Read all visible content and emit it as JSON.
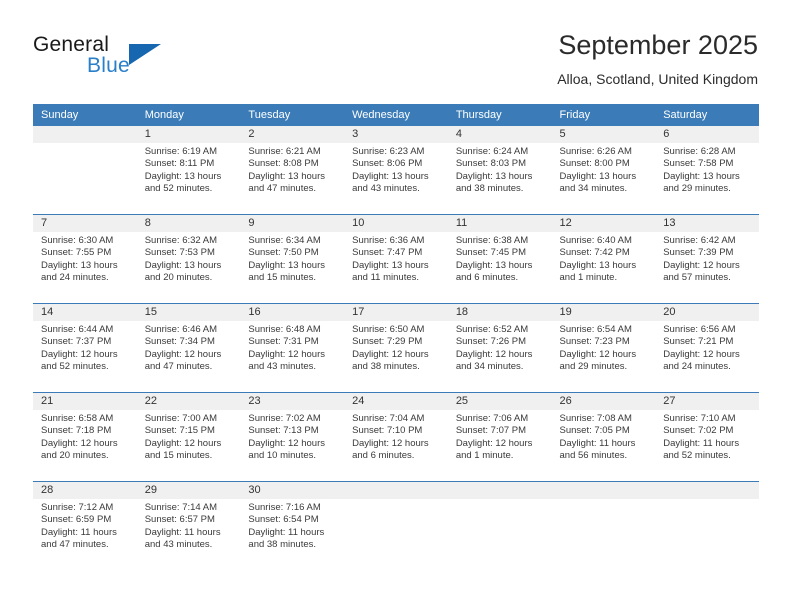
{
  "brand": {
    "word_one": "General",
    "word_two": "Blue",
    "flag_icon": "blue-triangle-flag-icon",
    "accent_color": "#1667b0",
    "blue_text_color": "#2a7fc9"
  },
  "header": {
    "month_title": "September 2025",
    "location": "Alloa, Scotland, United Kingdom"
  },
  "calendar": {
    "header_bg": "#3b7cb8",
    "daynum_bg": "#f0f0f0",
    "weekdays": [
      "Sunday",
      "Monday",
      "Tuesday",
      "Wednesday",
      "Thursday",
      "Friday",
      "Saturday"
    ],
    "weeks": [
      [
        {
          "day": "",
          "empty": true,
          "sunrise": "",
          "sunset": "",
          "daylight": ""
        },
        {
          "day": "1",
          "empty": false,
          "sunrise": "Sunrise: 6:19 AM",
          "sunset": "Sunset: 8:11 PM",
          "daylight": "Daylight: 13 hours and 52 minutes."
        },
        {
          "day": "2",
          "empty": false,
          "sunrise": "Sunrise: 6:21 AM",
          "sunset": "Sunset: 8:08 PM",
          "daylight": "Daylight: 13 hours and 47 minutes."
        },
        {
          "day": "3",
          "empty": false,
          "sunrise": "Sunrise: 6:23 AM",
          "sunset": "Sunset: 8:06 PM",
          "daylight": "Daylight: 13 hours and 43 minutes."
        },
        {
          "day": "4",
          "empty": false,
          "sunrise": "Sunrise: 6:24 AM",
          "sunset": "Sunset: 8:03 PM",
          "daylight": "Daylight: 13 hours and 38 minutes."
        },
        {
          "day": "5",
          "empty": false,
          "sunrise": "Sunrise: 6:26 AM",
          "sunset": "Sunset: 8:00 PM",
          "daylight": "Daylight: 13 hours and 34 minutes."
        },
        {
          "day": "6",
          "empty": false,
          "sunrise": "Sunrise: 6:28 AM",
          "sunset": "Sunset: 7:58 PM",
          "daylight": "Daylight: 13 hours and 29 minutes."
        }
      ],
      [
        {
          "day": "7",
          "empty": false,
          "sunrise": "Sunrise: 6:30 AM",
          "sunset": "Sunset: 7:55 PM",
          "daylight": "Daylight: 13 hours and 24 minutes."
        },
        {
          "day": "8",
          "empty": false,
          "sunrise": "Sunrise: 6:32 AM",
          "sunset": "Sunset: 7:53 PM",
          "daylight": "Daylight: 13 hours and 20 minutes."
        },
        {
          "day": "9",
          "empty": false,
          "sunrise": "Sunrise: 6:34 AM",
          "sunset": "Sunset: 7:50 PM",
          "daylight": "Daylight: 13 hours and 15 minutes."
        },
        {
          "day": "10",
          "empty": false,
          "sunrise": "Sunrise: 6:36 AM",
          "sunset": "Sunset: 7:47 PM",
          "daylight": "Daylight: 13 hours and 11 minutes."
        },
        {
          "day": "11",
          "empty": false,
          "sunrise": "Sunrise: 6:38 AM",
          "sunset": "Sunset: 7:45 PM",
          "daylight": "Daylight: 13 hours and 6 minutes."
        },
        {
          "day": "12",
          "empty": false,
          "sunrise": "Sunrise: 6:40 AM",
          "sunset": "Sunset: 7:42 PM",
          "daylight": "Daylight: 13 hours and 1 minute."
        },
        {
          "day": "13",
          "empty": false,
          "sunrise": "Sunrise: 6:42 AM",
          "sunset": "Sunset: 7:39 PM",
          "daylight": "Daylight: 12 hours and 57 minutes."
        }
      ],
      [
        {
          "day": "14",
          "empty": false,
          "sunrise": "Sunrise: 6:44 AM",
          "sunset": "Sunset: 7:37 PM",
          "daylight": "Daylight: 12 hours and 52 minutes."
        },
        {
          "day": "15",
          "empty": false,
          "sunrise": "Sunrise: 6:46 AM",
          "sunset": "Sunset: 7:34 PM",
          "daylight": "Daylight: 12 hours and 47 minutes."
        },
        {
          "day": "16",
          "empty": false,
          "sunrise": "Sunrise: 6:48 AM",
          "sunset": "Sunset: 7:31 PM",
          "daylight": "Daylight: 12 hours and 43 minutes."
        },
        {
          "day": "17",
          "empty": false,
          "sunrise": "Sunrise: 6:50 AM",
          "sunset": "Sunset: 7:29 PM",
          "daylight": "Daylight: 12 hours and 38 minutes."
        },
        {
          "day": "18",
          "empty": false,
          "sunrise": "Sunrise: 6:52 AM",
          "sunset": "Sunset: 7:26 PM",
          "daylight": "Daylight: 12 hours and 34 minutes."
        },
        {
          "day": "19",
          "empty": false,
          "sunrise": "Sunrise: 6:54 AM",
          "sunset": "Sunset: 7:23 PM",
          "daylight": "Daylight: 12 hours and 29 minutes."
        },
        {
          "day": "20",
          "empty": false,
          "sunrise": "Sunrise: 6:56 AM",
          "sunset": "Sunset: 7:21 PM",
          "daylight": "Daylight: 12 hours and 24 minutes."
        }
      ],
      [
        {
          "day": "21",
          "empty": false,
          "sunrise": "Sunrise: 6:58 AM",
          "sunset": "Sunset: 7:18 PM",
          "daylight": "Daylight: 12 hours and 20 minutes."
        },
        {
          "day": "22",
          "empty": false,
          "sunrise": "Sunrise: 7:00 AM",
          "sunset": "Sunset: 7:15 PM",
          "daylight": "Daylight: 12 hours and 15 minutes."
        },
        {
          "day": "23",
          "empty": false,
          "sunrise": "Sunrise: 7:02 AM",
          "sunset": "Sunset: 7:13 PM",
          "daylight": "Daylight: 12 hours and 10 minutes."
        },
        {
          "day": "24",
          "empty": false,
          "sunrise": "Sunrise: 7:04 AM",
          "sunset": "Sunset: 7:10 PM",
          "daylight": "Daylight: 12 hours and 6 minutes."
        },
        {
          "day": "25",
          "empty": false,
          "sunrise": "Sunrise: 7:06 AM",
          "sunset": "Sunset: 7:07 PM",
          "daylight": "Daylight: 12 hours and 1 minute."
        },
        {
          "day": "26",
          "empty": false,
          "sunrise": "Sunrise: 7:08 AM",
          "sunset": "Sunset: 7:05 PM",
          "daylight": "Daylight: 11 hours and 56 minutes."
        },
        {
          "day": "27",
          "empty": false,
          "sunrise": "Sunrise: 7:10 AM",
          "sunset": "Sunset: 7:02 PM",
          "daylight": "Daylight: 11 hours and 52 minutes."
        }
      ],
      [
        {
          "day": "28",
          "empty": false,
          "sunrise": "Sunrise: 7:12 AM",
          "sunset": "Sunset: 6:59 PM",
          "daylight": "Daylight: 11 hours and 47 minutes."
        },
        {
          "day": "29",
          "empty": false,
          "sunrise": "Sunrise: 7:14 AM",
          "sunset": "Sunset: 6:57 PM",
          "daylight": "Daylight: 11 hours and 43 minutes."
        },
        {
          "day": "30",
          "empty": false,
          "sunrise": "Sunrise: 7:16 AM",
          "sunset": "Sunset: 6:54 PM",
          "daylight": "Daylight: 11 hours and 38 minutes."
        },
        {
          "day": "",
          "empty": true,
          "sunrise": "",
          "sunset": "",
          "daylight": ""
        },
        {
          "day": "",
          "empty": true,
          "sunrise": "",
          "sunset": "",
          "daylight": ""
        },
        {
          "day": "",
          "empty": true,
          "sunrise": "",
          "sunset": "",
          "daylight": ""
        },
        {
          "day": "",
          "empty": true,
          "sunrise": "",
          "sunset": "",
          "daylight": ""
        }
      ]
    ]
  }
}
